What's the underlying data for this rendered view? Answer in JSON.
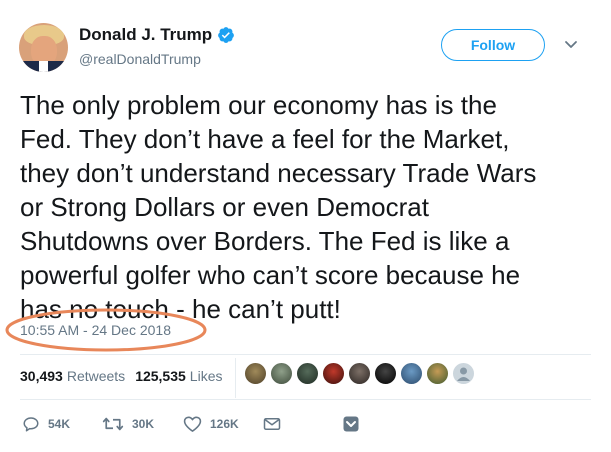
{
  "author": {
    "display_name": "Donald J. Trump",
    "handle": "@realDonaldTrump",
    "verified_icon": "verified-badge-icon"
  },
  "follow_label": "Follow",
  "tweet": {
    "text": "The only problem our economy has is the\nFed. They don’t have a feel for the Market,\nthey don’t understand necessary Trade Wars\nor Strong Dollars or even Democrat\nShutdowns over Borders. The Fed is like a\npowerful golfer who can’t score because he\nhas no touch - he can’t putt!",
    "timestamp": "10:55 AM - 24 Dec 2018"
  },
  "stats": {
    "retweets_count": "30,493",
    "retweets_label": "Retweets",
    "likes_count": "125,535",
    "likes_label": "Likes"
  },
  "actions": {
    "reply_count": "54K",
    "retweet_count": "30K",
    "like_count": "126K"
  },
  "colors": {
    "accent": "#1da1f2",
    "annotation_ellipse": "#e8875a",
    "secondary_text": "#657786"
  }
}
